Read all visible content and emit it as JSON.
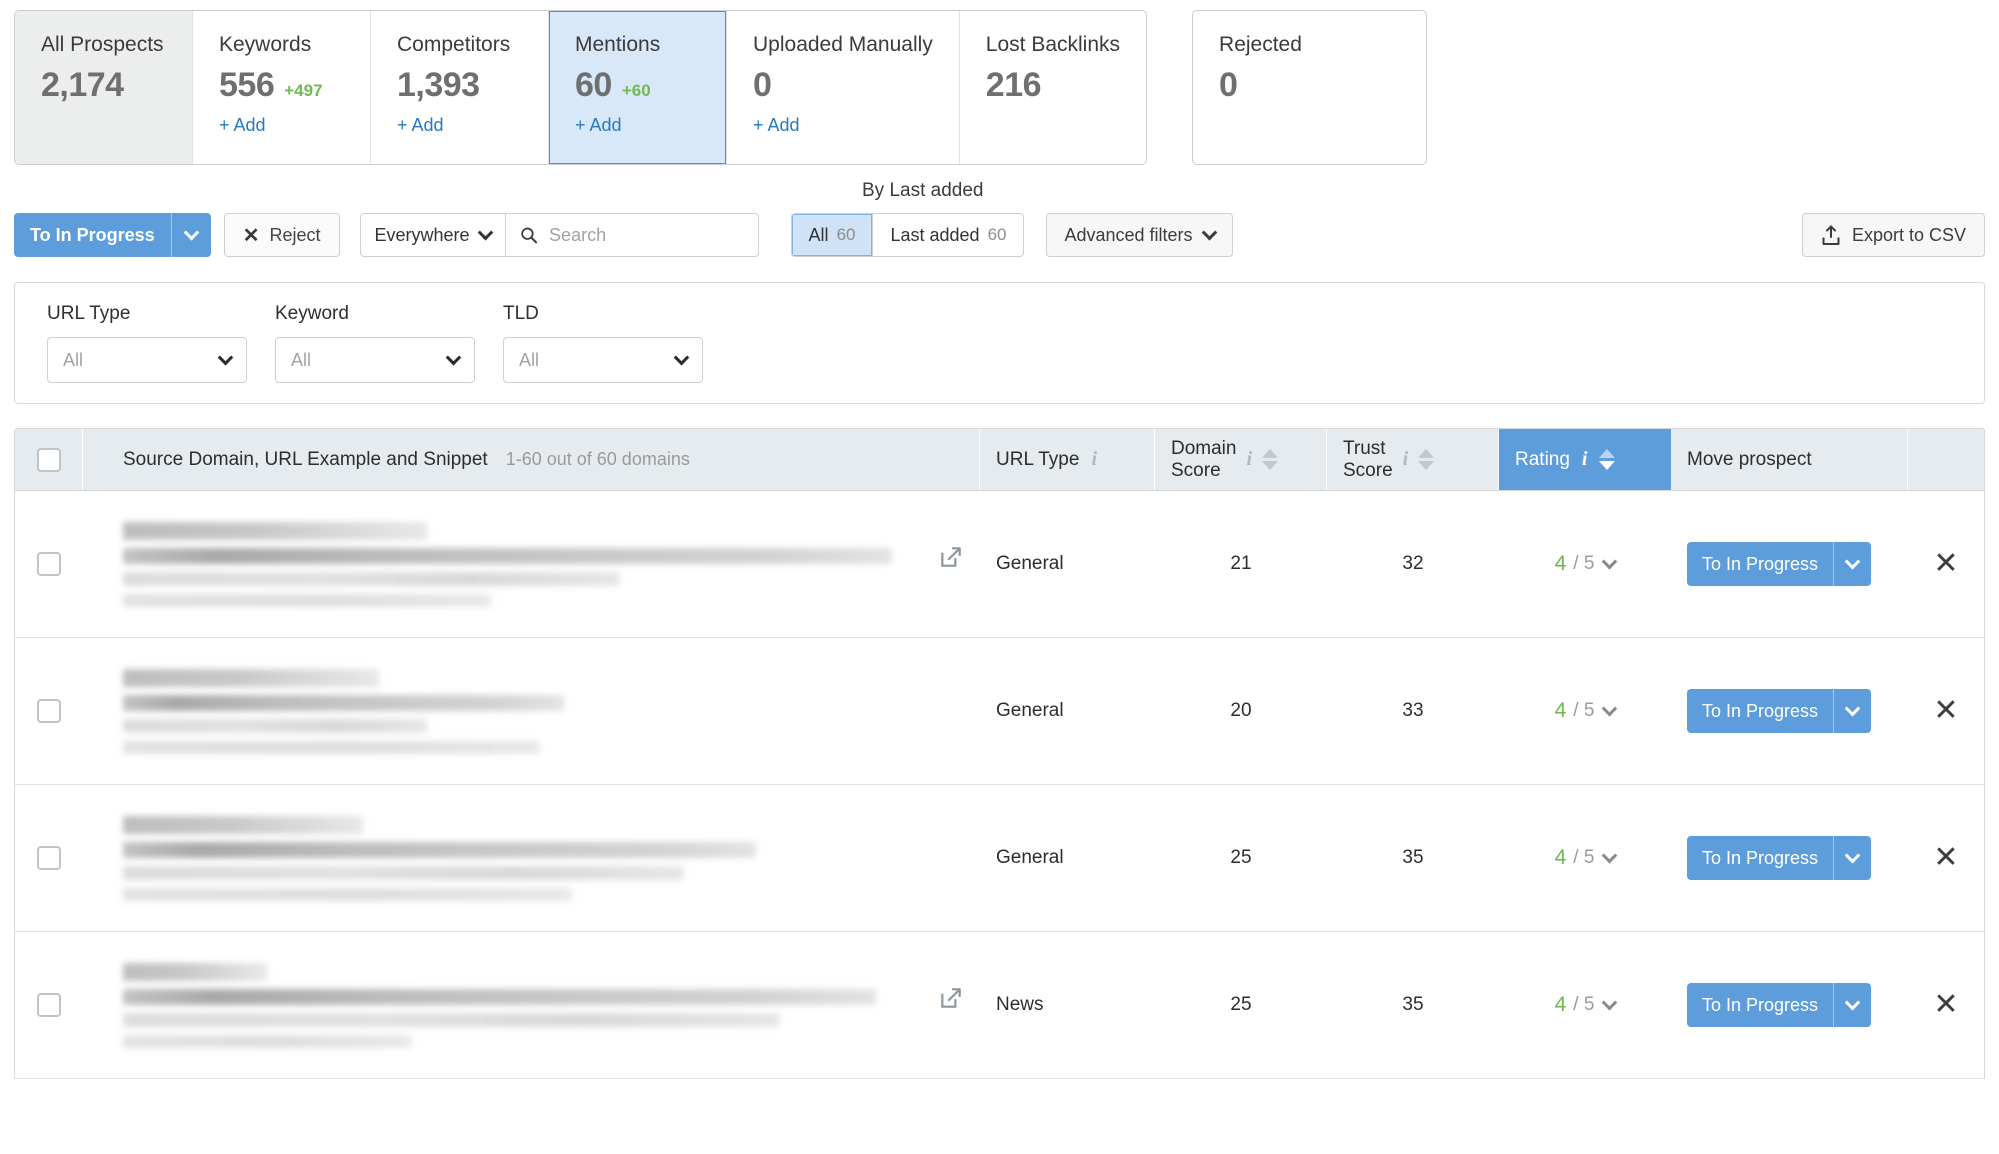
{
  "stat_tabs": [
    {
      "label": "All Prospects",
      "value": "2,174",
      "delta": null,
      "add_label": null,
      "state": "grey"
    },
    {
      "label": "Keywords",
      "value": "556",
      "delta": "+497",
      "add_label": "+ Add",
      "state": "normal"
    },
    {
      "label": "Competitors",
      "value": "1,393",
      "delta": null,
      "add_label": "+ Add",
      "state": "normal"
    },
    {
      "label": "Mentions",
      "value": "60",
      "delta": "+60",
      "add_label": "+ Add",
      "state": "active"
    },
    {
      "label": "Uploaded Manually",
      "value": "0",
      "delta": null,
      "add_label": "+ Add",
      "state": "normal"
    },
    {
      "label": "Lost Backlinks",
      "value": "216",
      "delta": null,
      "add_label": null,
      "state": "normal"
    }
  ],
  "standalone_tab": {
    "label": "Rejected",
    "value": "0"
  },
  "toolbar": {
    "move_button_label": "To In Progress",
    "reject_label": "Reject",
    "scope_label": "Everywhere",
    "search_placeholder": "Search",
    "search_value": "",
    "sort_caption": "By Last added",
    "segments": [
      {
        "label": "All",
        "count": "60",
        "active": true
      },
      {
        "label": "Last added",
        "count": "60",
        "active": false
      }
    ],
    "advanced_filters_label": "Advanced filters",
    "export_label": "Export to CSV"
  },
  "filters": [
    {
      "label": "URL Type",
      "value": "All"
    },
    {
      "label": "Keyword",
      "value": "All"
    },
    {
      "label": "TLD",
      "value": "All"
    }
  ],
  "table": {
    "columns": {
      "main": "Source Domain, URL Example and Snippet",
      "main_count": "1-60 out of 60 domains",
      "url_type": "URL Type",
      "domain_score_line1": "Domain",
      "domain_score_line2": "Score",
      "trust_score_line1": "Trust",
      "trust_score_line2": "Score",
      "rating": "Rating",
      "move_prospect": "Move prospect"
    },
    "sorted_column": "Rating",
    "row_action_label": "To In Progress",
    "rows": [
      {
        "url_type": "General",
        "domain_score": "21",
        "trust_score": "32",
        "rating_value": "4",
        "rating_max": "/ 5",
        "has_external_link": true
      },
      {
        "url_type": "General",
        "domain_score": "20",
        "trust_score": "33",
        "rating_value": "4",
        "rating_max": "/ 5",
        "has_external_link": false
      },
      {
        "url_type": "General",
        "domain_score": "25",
        "trust_score": "35",
        "rating_value": "4",
        "rating_max": "/ 5",
        "has_external_link": false
      },
      {
        "url_type": "News",
        "domain_score": "25",
        "trust_score": "35",
        "rating_value": "4",
        "rating_max": "/ 5",
        "has_external_link": true
      }
    ]
  },
  "colors": {
    "accent_blue": "#5e9ddb",
    "active_tab_bg": "#d9e8f8",
    "positive_green": "#71bb54",
    "rating_green": "#6fb44f",
    "header_bg": "#e5ebee",
    "link_blue": "#277ac1"
  }
}
